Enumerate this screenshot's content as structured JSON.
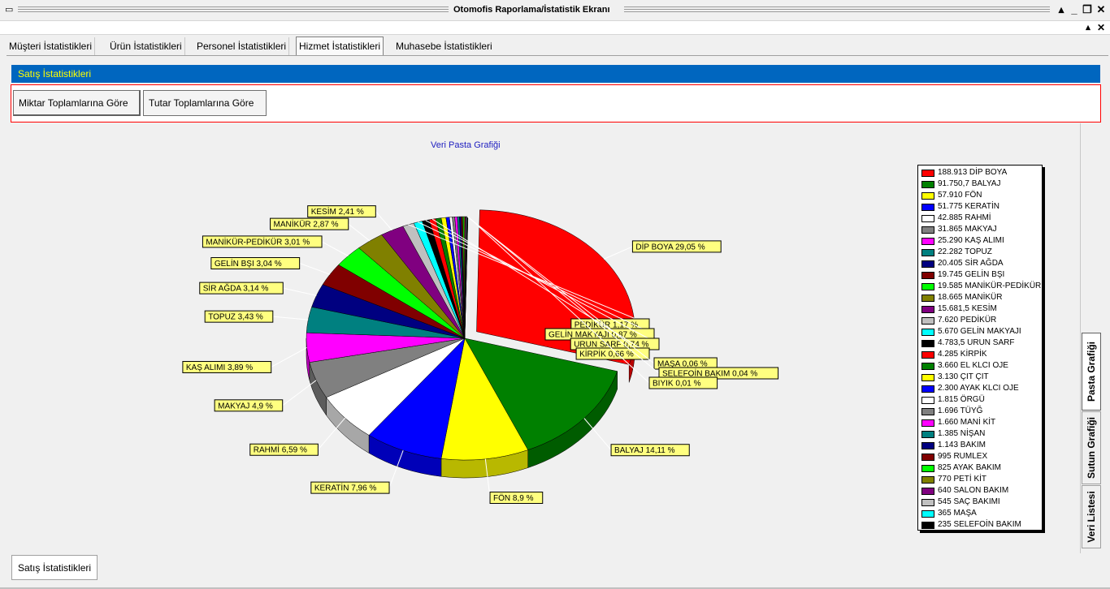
{
  "window": {
    "title": "Otomofis Raporlama/İstatistik Ekranı",
    "icons": {
      "system": "system-menu-icon",
      "help": "help-arrow-icon",
      "minimize": "minimize-icon",
      "restore": "restore-icon",
      "close": "close-icon"
    }
  },
  "tabs": [
    {
      "label": "Müşteri İstatistikleri"
    },
    {
      "label": "Ürün İstatistikleri"
    },
    {
      "label": "Personel İstatistikleri"
    },
    {
      "label": "Hizmet İstatistikleri"
    },
    {
      "label": "Muhasebe İstatistikleri"
    }
  ],
  "active_tab": "Hizmet İstatistikleri",
  "section_title": "Satış İstatistikleri",
  "buttons": {
    "quantity_totals": "Miktar Toplamlarına Göre",
    "amount_totals": "Tutar Toplamlarına Göre"
  },
  "side_tabs": {
    "pie": "Pasta Grafiği",
    "bar": "Sutun Grafiği",
    "list": "Veri Listesi"
  },
  "bottom_tab": "Satış İstatistikleri",
  "colors": {
    "header_band": "#0066bf",
    "header_text": "#ffff00",
    "panel_border": "#ff0000",
    "chart_title": "#2020c0"
  },
  "chart_data": {
    "type": "pie",
    "title": "Veri Pasta Grafiği",
    "legend_position": "right",
    "slices": [
      {
        "name": "DİP BOYA",
        "value": 188913,
        "value_label": "188.913",
        "percent_label": "29,05 %",
        "color": "#ff0000"
      },
      {
        "name": "BALYAJ",
        "value": 91750.7,
        "value_label": "91.750,7",
        "percent_label": "14,11 %",
        "color": "#008000"
      },
      {
        "name": "FÖN",
        "value": 57910,
        "value_label": "57.910",
        "percent_label": "8,9 %",
        "color": "#ffff00"
      },
      {
        "name": "KERATİN",
        "value": 51775,
        "value_label": "51.775",
        "percent_label": "7,96 %",
        "color": "#0000ff"
      },
      {
        "name": "RAHMİ",
        "value": 42885,
        "value_label": "42.885",
        "percent_label": "6,59 %",
        "color": "#ffffff"
      },
      {
        "name": "MAKYAJ",
        "value": 31865,
        "value_label": "31.865",
        "percent_label": "4,9 %",
        "color": "#808080"
      },
      {
        "name": "KAŞ ALIMI",
        "value": 25290,
        "value_label": "25.290",
        "percent_label": "3,89 %",
        "color": "#ff00ff"
      },
      {
        "name": "TOPUZ",
        "value": 22282,
        "value_label": "22.282",
        "percent_label": "3,43 %",
        "color": "#008080"
      },
      {
        "name": "SİR AĞDA",
        "value": 20405,
        "value_label": "20.405",
        "percent_label": "3,14 %",
        "color": "#000080"
      },
      {
        "name": "GELİN BŞI",
        "value": 19745,
        "value_label": "19.745",
        "percent_label": "3,04 %",
        "color": "#800000"
      },
      {
        "name": "MANİKÜR-PEDİKÜR",
        "value": 19585,
        "value_label": "19.585",
        "percent_label": "3,01 %",
        "color": "#00ff00"
      },
      {
        "name": "MANİKÜR",
        "value": 18665,
        "value_label": "18.665",
        "percent_label": "2,87 %",
        "color": "#808000"
      },
      {
        "name": "KESİM",
        "value": 15681.5,
        "value_label": "15.681,5",
        "percent_label": "2,41 %",
        "color": "#800080"
      },
      {
        "name": "PEDİKÜR",
        "value": 7620,
        "value_label": "7.620",
        "percent_label": "1,17 %",
        "color": "#c0c0c0"
      },
      {
        "name": "GELİN MAKYAJI",
        "value": 5670,
        "value_label": "5.670",
        "percent_label": "0,87 %",
        "color": "#00ffff"
      },
      {
        "name": "URUN SARF",
        "value": 4783.5,
        "value_label": "4.783,5",
        "percent_label": "0,74 %",
        "color": "#000000"
      },
      {
        "name": "KİRPİK",
        "value": 4285,
        "value_label": "4.285",
        "percent_label": "0,66 %",
        "color": "#ff0000"
      },
      {
        "name": "EL KLCI OJE",
        "value": 3660,
        "value_label": "3.660",
        "percent_label": "",
        "color": "#008000"
      },
      {
        "name": "ÇIT ÇIT",
        "value": 3130,
        "value_label": "3.130",
        "percent_label": "",
        "color": "#ffff00"
      },
      {
        "name": "AYAK KLCI OJE",
        "value": 2300,
        "value_label": "2.300",
        "percent_label": "",
        "color": "#0000ff"
      },
      {
        "name": "ÖRGÜ",
        "value": 1815,
        "value_label": "1.815",
        "percent_label": "",
        "color": "#ffffff"
      },
      {
        "name": "TÜYĞ",
        "value": 1696,
        "value_label": "1.696",
        "percent_label": "",
        "color": "#808080"
      },
      {
        "name": "MANİ KİT",
        "value": 1660,
        "value_label": "1.660",
        "percent_label": "",
        "color": "#ff00ff"
      },
      {
        "name": "NİŞAN",
        "value": 1385,
        "value_label": "1.385",
        "percent_label": "",
        "color": "#008080"
      },
      {
        "name": "BAKIM",
        "value": 1143,
        "value_label": "1.143",
        "percent_label": "",
        "color": "#000080"
      },
      {
        "name": "RUMLEX",
        "value": 995,
        "value_label": "995",
        "percent_label": "",
        "color": "#800000"
      },
      {
        "name": "AYAK BAKIM",
        "value": 825,
        "value_label": "825",
        "percent_label": "",
        "color": "#00ff00"
      },
      {
        "name": "PETİ KİT",
        "value": 770,
        "value_label": "770",
        "percent_label": "",
        "color": "#808000"
      },
      {
        "name": "SALON BAKIM",
        "value": 640,
        "value_label": "640",
        "percent_label": "",
        "color": "#800080"
      },
      {
        "name": "SAÇ BAKIMI",
        "value": 545,
        "value_label": "545",
        "percent_label": "",
        "color": "#c0c0c0"
      },
      {
        "name": "MAŞA",
        "value": 365,
        "value_label": "365",
        "percent_label": "0,06 %",
        "color": "#00ffff"
      },
      {
        "name": "SELEFOİN  BAKIM",
        "value": 235,
        "value_label": "235",
        "percent_label": "0,04 %",
        "color": "#000000"
      },
      {
        "name": "BIYIK",
        "value": 65,
        "value_label": "",
        "percent_label": "0,01 %",
        "color": "#ff0000"
      }
    ],
    "legend_entries": [
      "188.913 DİP BOYA",
      "91.750,7 BALYAJ",
      "57.910 FÖN",
      "51.775 KERATİN",
      "42.885 RAHMİ",
      "31.865 MAKYAJ",
      "25.290 KAŞ ALIMI",
      "22.282 TOPUZ",
      "20.405 SİR AĞDA",
      "19.745 GELİN BŞI",
      "19.585 MANİKÜR-PEDİKÜR",
      "18.665 MANİKÜR",
      "15.681,5 KESİM",
      "7.620 PEDİKÜR",
      "5.670 GELİN MAKYAJI",
      "4.783,5 URUN SARF",
      "4.285 KİRPİK",
      "3.660 EL KLCI OJE",
      "3.130 ÇIT ÇIT",
      "2.300 AYAK KLCI OJE",
      "1.815 ÖRGÜ",
      "1.696 TÜYĞ",
      "1.660 MANİ KİT",
      "1.385 NİŞAN",
      "1.143 BAKIM",
      "995 RUMLEX",
      "825 AYAK BAKIM",
      "770 PETİ KİT",
      "640 SALON BAKIM",
      "545 SAÇ BAKIMI",
      "365 MAŞA",
      "235 SELEFOİN  BAKIM"
    ],
    "data_labels": [
      "DİP BOYA 29,05 %",
      "BALYAJ 14,11 %",
      "FÖN 8,9 %",
      "KERATİN 7,96 %",
      "RAHMİ 6,59 %",
      "MAKYAJ 4,9 %",
      "KAŞ ALIMI 3,89 %",
      "TOPUZ 3,43 %",
      "SİR AĞDA 3,14 %",
      "GELİN BŞI 3,04 %",
      "MANİKÜR-PEDİKÜR 3,01 %",
      "MANİKÜR 2,87 %",
      "KESİM 2,41 %",
      "PEDİKÜR 1,17 %",
      "GELİN MAKYAJI 0,87 %",
      "URUN SARF 0,74 %",
      "KİRPİK 0,66 %",
      "BIYIK 0,01 %",
      "MAŞA 0,06 %",
      "KIM 0,04 %"
    ]
  }
}
